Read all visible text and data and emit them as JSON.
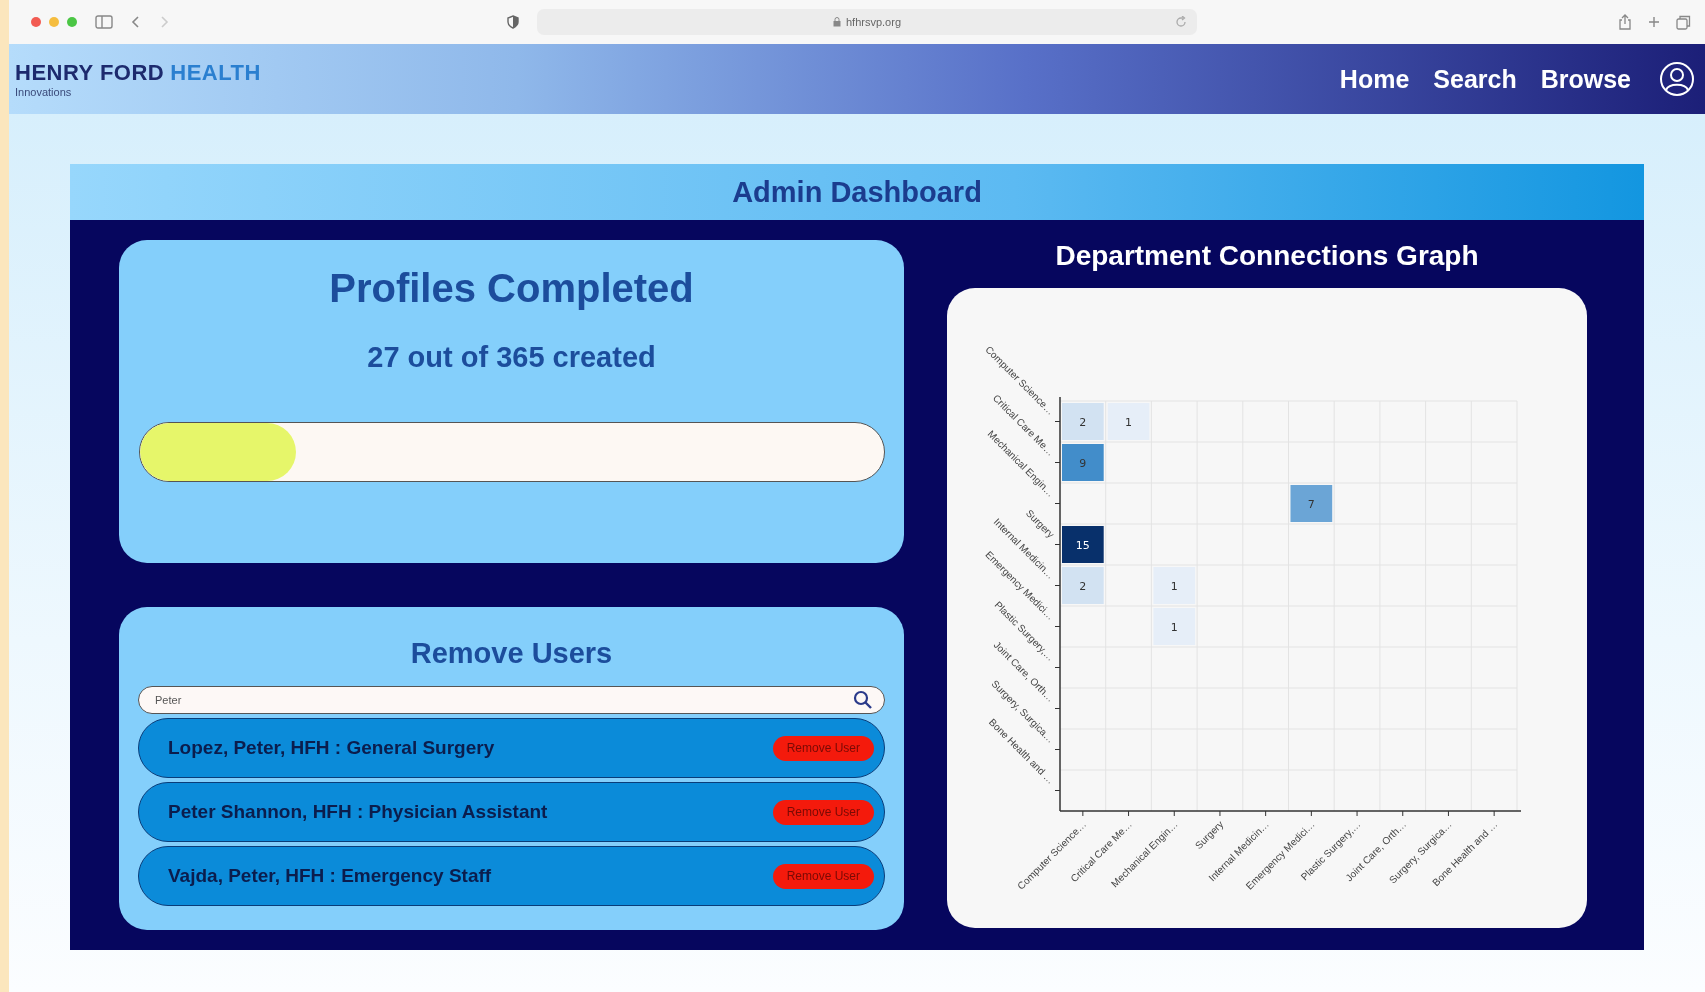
{
  "browser": {
    "url": "hfhrsvp.org"
  },
  "header": {
    "logo": {
      "name": "HENRY FORD",
      "accent": "HEALTH",
      "tagline": "Innovations"
    },
    "nav": [
      {
        "label": "Home"
      },
      {
        "label": "Search"
      },
      {
        "label": "Browse"
      }
    ]
  },
  "dashboard": {
    "title": "Admin Dashboard",
    "profiles": {
      "title": "Profiles Completed",
      "summary": "27 out of 365 created",
      "level": 0.21
    },
    "remove_users": {
      "title": "Remove Users",
      "search": {
        "value": "Peter"
      },
      "users": [
        {
          "name": "Lopez, Peter, HFH : General Surgery",
          "action": "Remove User"
        },
        {
          "name": "Peter Shannon, HFH : Physician Assistant",
          "action": "Remove User"
        },
        {
          "name": "Vajda, Peter, HFH : Emergency Staff",
          "action": "Remove User"
        }
      ]
    },
    "graph": {
      "title": "Department Connections Graph",
      "y_labels": [
        "Computer Science…",
        "Critical Care Me…",
        "Mechanical Engin…",
        "Surgery",
        "Internal Medicin…",
        "Emergency Medici…",
        "Plastic Surgery,…",
        "Joint Care, Orth…",
        "Surgery, Surgica…",
        "Bone Health and …"
      ],
      "x_labels": [
        "Computer Science…",
        "Critical Care Me…",
        "Mechanical Engin…",
        "Surgery",
        "Internal Medicin…",
        "Emergency Medici…",
        "Plastic Surgery,…",
        "Joint Care, Orth…",
        "Surgery, Surgica…",
        "Bone Health and …"
      ],
      "rows": [
        [
          "2",
          "1",
          null,
          null,
          null,
          null,
          null,
          null,
          null,
          null
        ],
        [
          "9",
          null,
          null,
          null,
          null,
          null,
          null,
          null,
          null,
          null
        ],
        [
          null,
          null,
          null,
          null,
          null,
          "7",
          null,
          null,
          null,
          null
        ],
        [
          "15",
          null,
          null,
          null,
          null,
          null,
          null,
          null,
          null,
          null
        ],
        [
          "2",
          null,
          "1",
          null,
          null,
          null,
          null,
          null,
          null,
          null
        ],
        [
          null,
          null,
          "1",
          null,
          null,
          null,
          null,
          null,
          null,
          null
        ],
        [
          null,
          null,
          null,
          null,
          null,
          null,
          null,
          null,
          null,
          null
        ],
        [
          null,
          null,
          null,
          null,
          null,
          null,
          null,
          null,
          null,
          null
        ],
        [
          null,
          null,
          null,
          null,
          null,
          null,
          null,
          null,
          null,
          null
        ],
        [
          null,
          null,
          null,
          null,
          null,
          null,
          null,
          null,
          null,
          null
        ]
      ]
    }
  }
}
